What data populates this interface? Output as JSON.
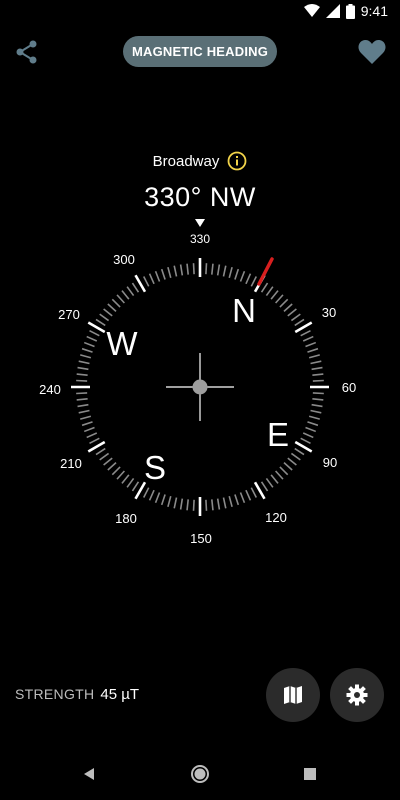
{
  "status_bar": {
    "time": "9:41",
    "icons": [
      "wifi-icon",
      "cellular-icon",
      "battery-icon"
    ]
  },
  "top_bar": {
    "mode_label": "MAGNETIC HEADING",
    "left_icon": "share-icon",
    "right_icon": "heart-icon"
  },
  "location": {
    "name": "Broadway",
    "info_icon": "info-icon",
    "info_color": "#f2d44a"
  },
  "heading": {
    "readout": "330° NW",
    "degrees": 330,
    "marker_label": "330"
  },
  "compass": {
    "cardinals": [
      "N",
      "E",
      "S",
      "W"
    ],
    "degree_labels": [
      "330",
      "30",
      "60",
      "90",
      "120",
      "150",
      "180",
      "210",
      "240",
      "270",
      "300"
    ],
    "needle_color": "#d81f1f"
  },
  "strength": {
    "label": "STRENGTH",
    "value": "45 µT"
  },
  "fabs": {
    "map_icon": "map-icon",
    "settings_icon": "gear-icon"
  },
  "nav": {
    "back": "back-icon",
    "home": "home-icon",
    "recents": "recents-icon"
  },
  "colors": {
    "background": "#000000",
    "pill": "#5a6f76",
    "accent_icons": "#607d8b"
  }
}
